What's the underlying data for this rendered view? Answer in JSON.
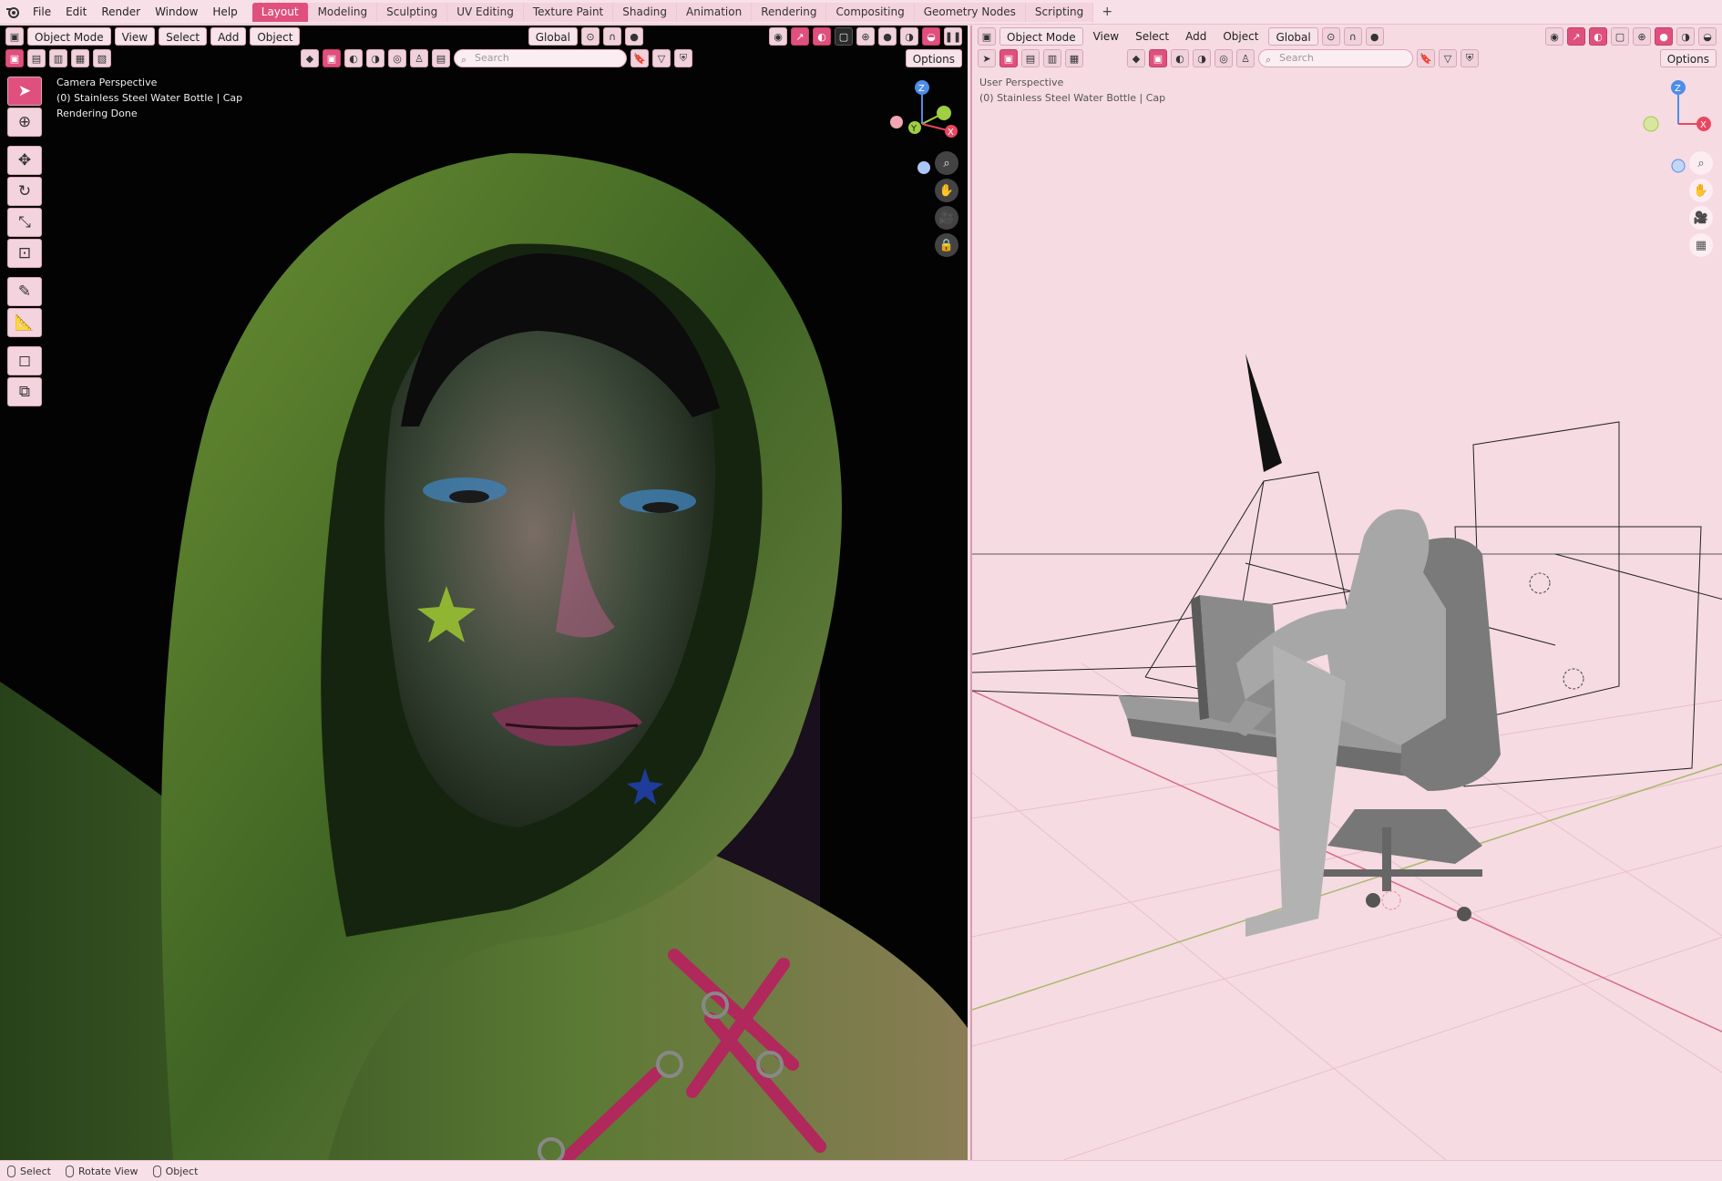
{
  "top_menu": [
    "File",
    "Edit",
    "Render",
    "Window",
    "Help"
  ],
  "workspace_tabs": [
    {
      "label": "Layout",
      "active": true
    },
    {
      "label": "Modeling"
    },
    {
      "label": "Sculpting"
    },
    {
      "label": "UV Editing"
    },
    {
      "label": "Texture Paint"
    },
    {
      "label": "Shading"
    },
    {
      "label": "Animation"
    },
    {
      "label": "Rendering"
    },
    {
      "label": "Compositing"
    },
    {
      "label": "Geometry Nodes"
    },
    {
      "label": "Scripting"
    }
  ],
  "workspace_add": "+",
  "left_view": {
    "mode": "Object Mode",
    "menu": [
      "View",
      "Select",
      "Add",
      "Object"
    ],
    "transform": "Global",
    "search_placeholder": "Search",
    "options": "Options",
    "overlay": {
      "line1": "Camera Perspective",
      "line2": "(0) Stainless Steel Water Bottle | Cap",
      "line3": "Rendering Done"
    },
    "gizmo": {
      "z": "Z",
      "y": "Y",
      "x": "X"
    }
  },
  "right_view": {
    "mode": "Object Mode",
    "menu": [
      "View",
      "Select",
      "Add",
      "Object"
    ],
    "transform": "Global",
    "search_placeholder": "Search",
    "options": "Options",
    "overlay": {
      "line1": "User Perspective",
      "line2": "(0) Stainless Steel Water Bottle | Cap"
    },
    "gizmo": {
      "z": "Z",
      "x": "X"
    }
  },
  "status": [
    {
      "label": "Select"
    },
    {
      "label": "Rotate View"
    },
    {
      "label": "Object"
    }
  ],
  "colors": {
    "accent": "#e0507e",
    "ui_bg": "#f6dbe3",
    "axis_x": "#e8485f",
    "axis_y": "#9fcf42",
    "axis_z": "#4d8ee8"
  }
}
